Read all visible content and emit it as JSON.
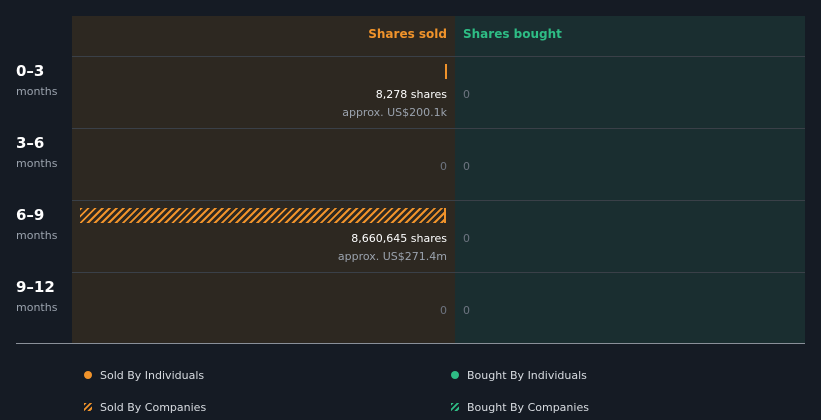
{
  "colors": {
    "sold": "#f0932b",
    "bought": "#2ebd85",
    "sold_panel": "#2d2821",
    "bought_panel": "#1a2e30",
    "background": "#151b24"
  },
  "chart_data": {
    "type": "bar",
    "orientation": "horizontal-diverging",
    "headers": {
      "sold": "Shares sold",
      "bought": "Shares bought"
    },
    "categories": [
      {
        "label": "0–3",
        "unit": "months"
      },
      {
        "label": "3–6",
        "unit": "months"
      },
      {
        "label": "6–9",
        "unit": "months"
      },
      {
        "label": "9–12",
        "unit": "months"
      }
    ],
    "sold": [
      {
        "shares": 8278,
        "shares_text": "8,278 shares",
        "approx_text": "approx. US$200.1k",
        "by_companies": false
      },
      {
        "shares": 0,
        "zero_text": "0"
      },
      {
        "shares": 8660645,
        "shares_text": "8,660,645 shares",
        "approx_text": "approx. US$271.4m",
        "by_companies": true
      },
      {
        "shares": 0,
        "zero_text": "0"
      }
    ],
    "bought": [
      {
        "shares": 0,
        "zero_text": "0"
      },
      {
        "shares": 0,
        "zero_text": "0"
      },
      {
        "shares": 0,
        "zero_text": "0"
      },
      {
        "shares": 0,
        "zero_text": "0"
      }
    ],
    "max_shares": 8660645,
    "legend": [
      {
        "label": "Sold By Individuals",
        "icon": "orange-dot",
        "color": "#f0932b"
      },
      {
        "label": "Bought By Individuals",
        "icon": "green-dot",
        "color": "#2ebd85"
      },
      {
        "label": "Sold By Companies",
        "icon": "orange-hatch",
        "color": "#f0932b"
      },
      {
        "label": "Bought By Companies",
        "icon": "green-hatch",
        "color": "#2ebd85"
      }
    ]
  }
}
